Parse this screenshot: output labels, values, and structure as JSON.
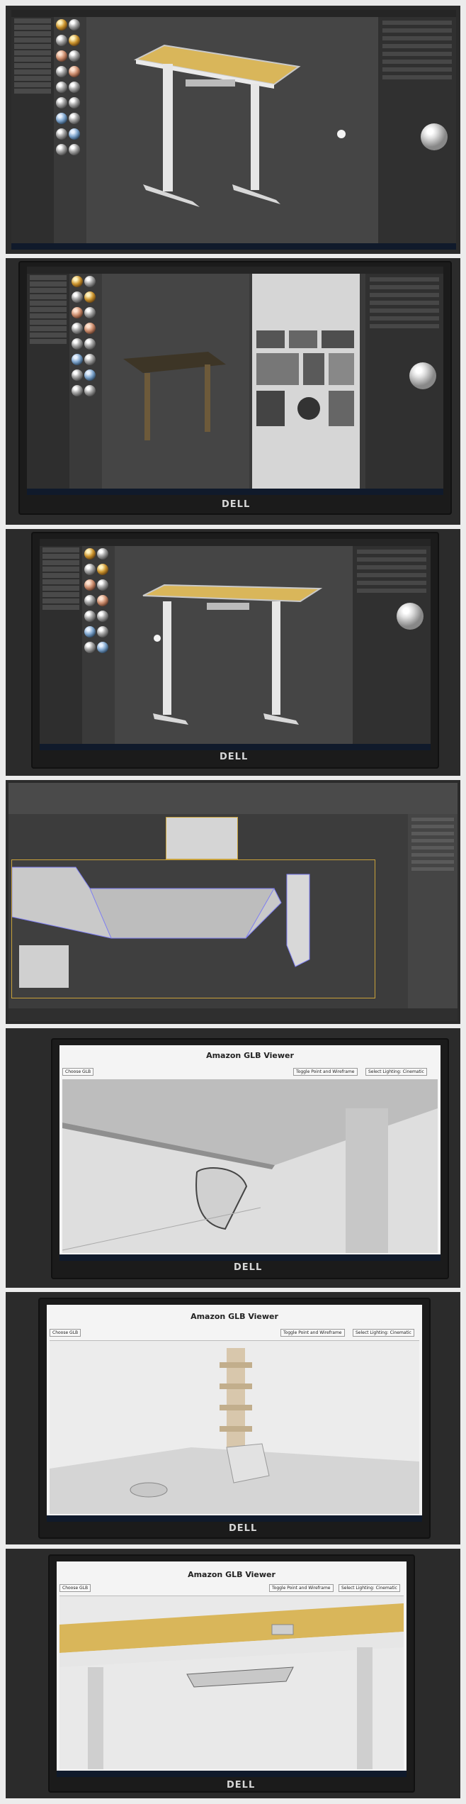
{
  "photos": [
    {
      "brand": ""
    },
    {
      "brand": "DELL"
    },
    {
      "brand": "DELL"
    },
    {
      "brand": ""
    },
    {
      "brand": "DELL",
      "viewer_title": "Amazon GLB Viewer",
      "choose_label": "Choose GLB",
      "toggle_label": "Toggle Point and Wireframe",
      "lighting_label": "Select Lighting: Cinematic"
    },
    {
      "brand": "DELL",
      "viewer_title": "Amazon GLB Viewer",
      "choose_label": "Choose GLB",
      "toggle_label": "Toggle Point and Wireframe",
      "lighting_label": "Select Lighting: Cinematic"
    },
    {
      "brand": "DELL",
      "viewer_title": "Amazon GLB Viewer",
      "choose_label": "Choose GLB",
      "toggle_label": "Toggle Point and Wireframe",
      "lighting_label": "Select Lighting: Cinematic"
    }
  ],
  "colors": {
    "desk_top": "#d9b65a",
    "desk_frame": "#e6e6e6",
    "desk_frame_dark": "#3d3526",
    "app_dark": "#3a3a3a",
    "glb_bg": "#f4f4f4",
    "selection": "#7e7ef2"
  }
}
